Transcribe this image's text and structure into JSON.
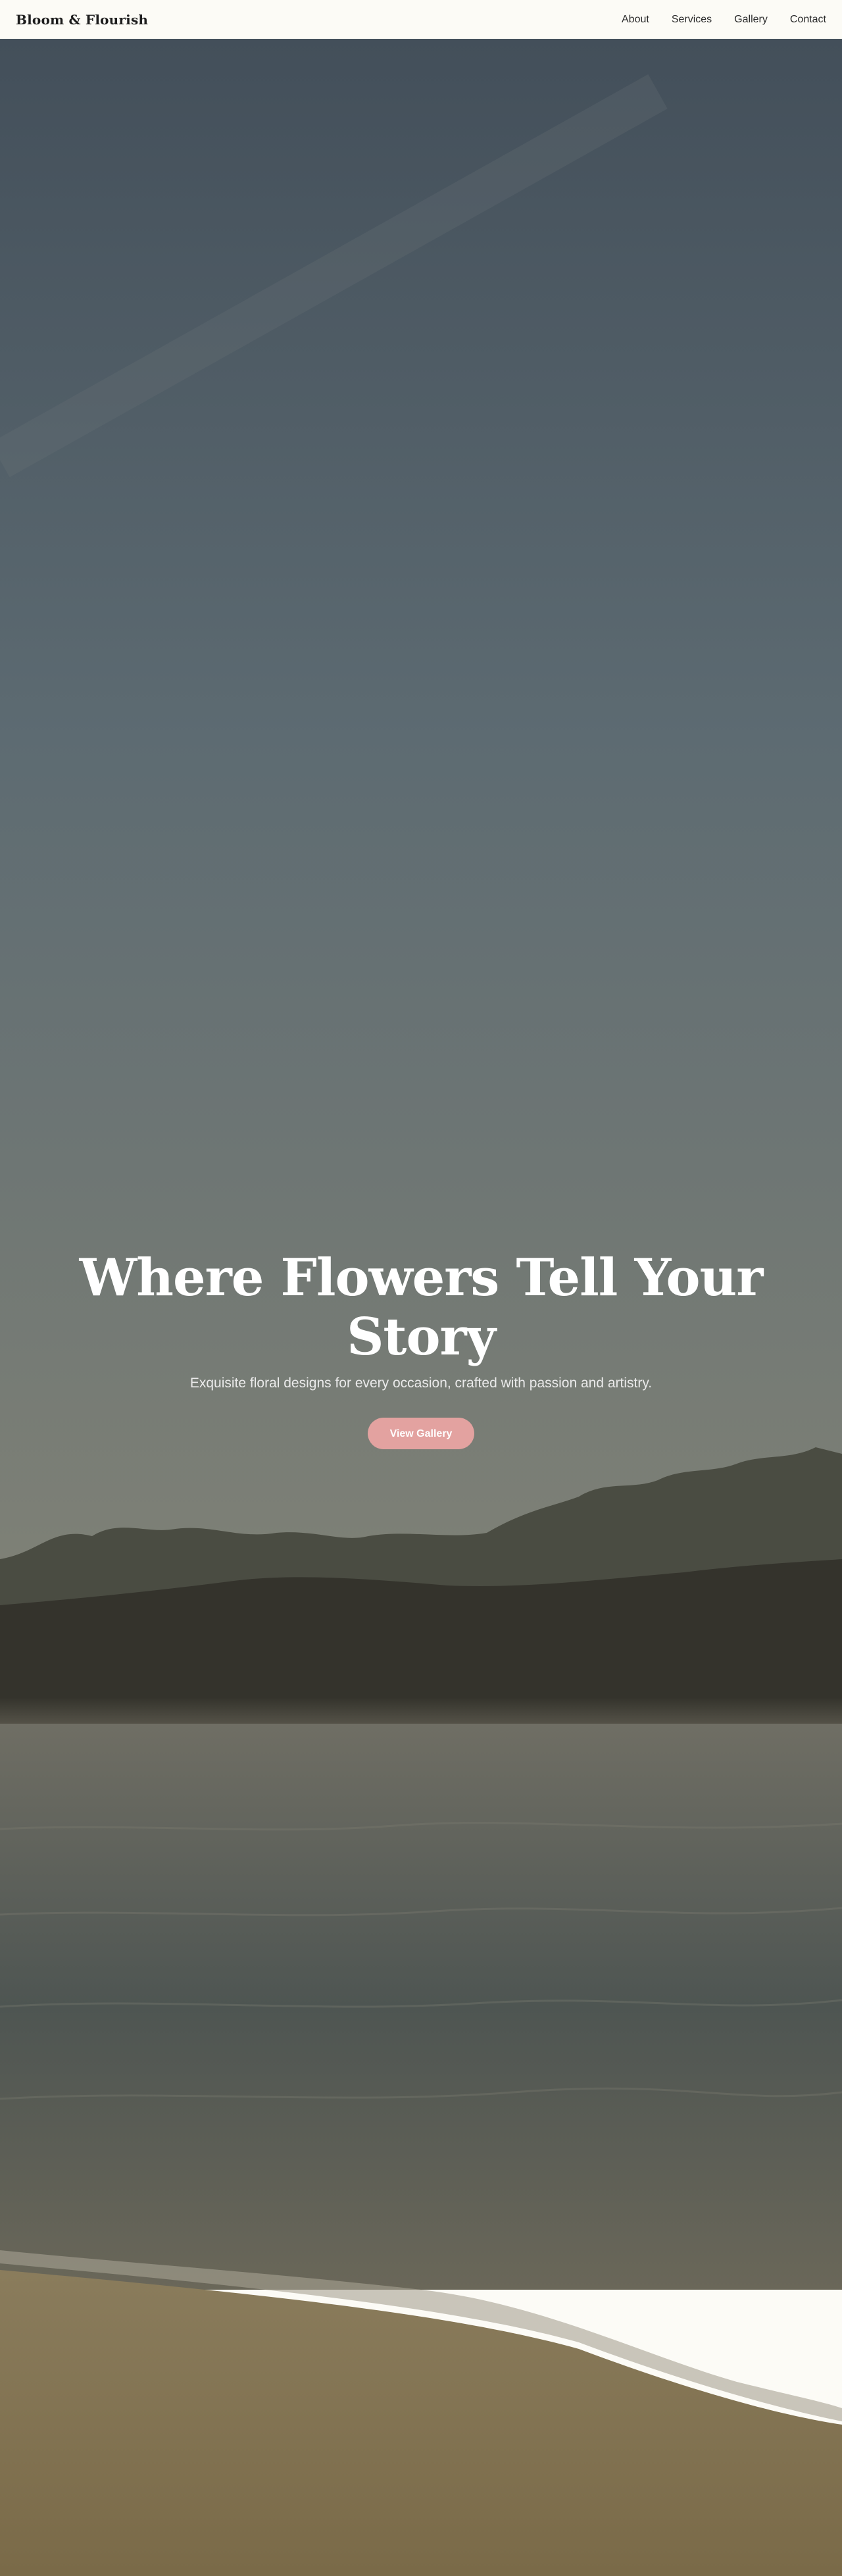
{
  "nav": {
    "brand": "Bloom & Flourish",
    "links": [
      {
        "label": "About"
      },
      {
        "label": "Services"
      },
      {
        "label": "Gallery"
      },
      {
        "label": "Contact"
      }
    ]
  },
  "hero": {
    "title": "Where Flowers Tell Your Story",
    "subtitle": "Exquisite floral designs for every occasion, crafted with passion and artistry.",
    "cta_label": "View Gallery",
    "background_image": "beach-sunrise-photo"
  },
  "colors": {
    "nav_bg": "#fcfbf6",
    "cta_bg": "#e3a2a0",
    "hero_text": "#ffffff"
  }
}
